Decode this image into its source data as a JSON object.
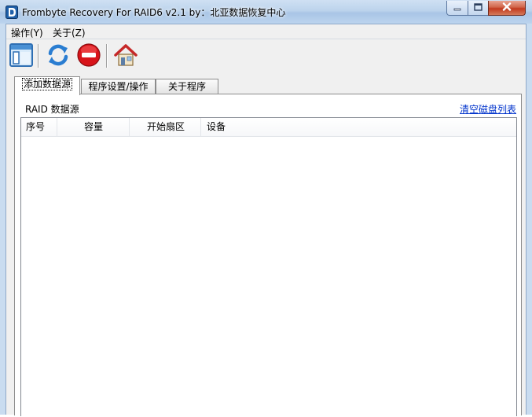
{
  "window": {
    "title": "Frombyte Recovery For RAID6 v2.1 by：北亚数据恢复中心",
    "controls": {
      "minimize": "minimize-icon",
      "maximize": "maximize-icon",
      "close": "close-icon"
    }
  },
  "menu": {
    "items": [
      {
        "label": "操作(Y)"
      },
      {
        "label": "关于(Z)"
      }
    ]
  },
  "toolbar": {
    "buttons": [
      {
        "icon": "layout-window-icon"
      },
      {
        "icon": "refresh-icon"
      },
      {
        "icon": "stop-icon"
      },
      {
        "icon": "home-icon"
      }
    ]
  },
  "tabs": [
    {
      "label": "添加数据源",
      "active": true
    },
    {
      "label": "程序设置/操作",
      "active": false
    },
    {
      "label": "关于程序",
      "active": false
    }
  ],
  "panel": {
    "section_label": "RAID 数据源",
    "clear_link": "清空磁盘列表",
    "table": {
      "columns": [
        "序号",
        "容量",
        "开始扇区",
        "设备"
      ],
      "rows": []
    }
  },
  "colors": {
    "titlebar": "#bcd3ec",
    "close_button": "#c2391e",
    "link": "#0033cc"
  }
}
